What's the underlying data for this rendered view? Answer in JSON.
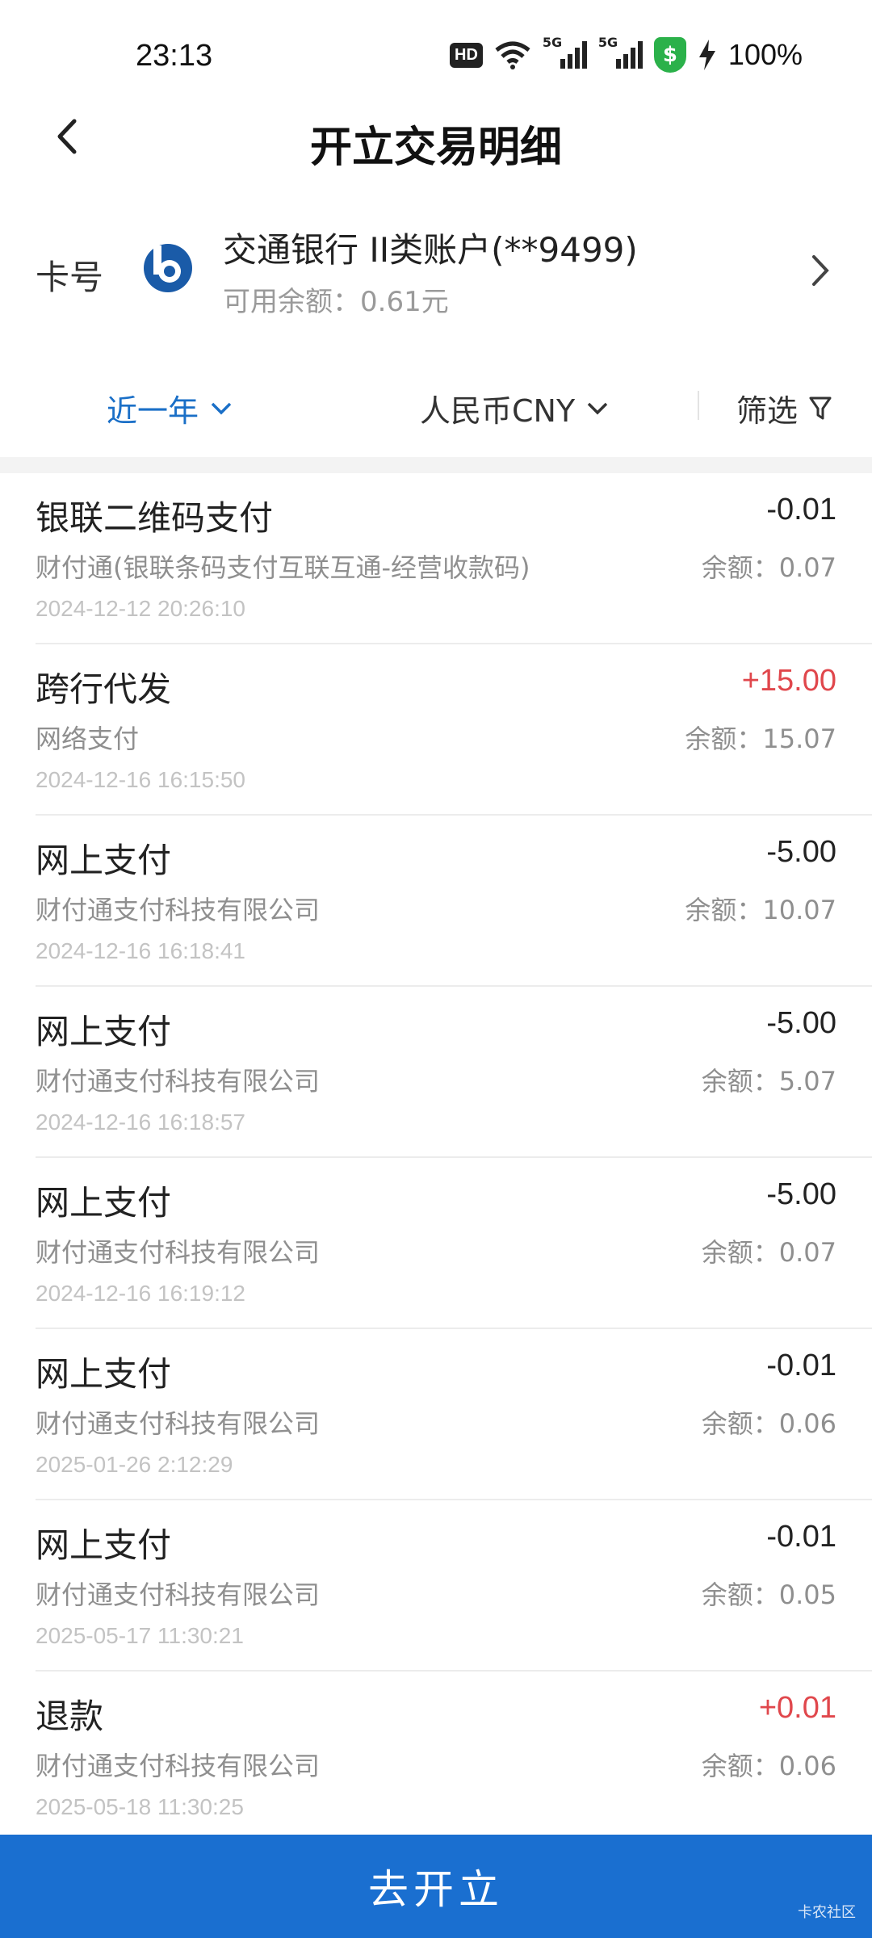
{
  "status": {
    "time": "23:13",
    "hd": "HD",
    "net1": "5G",
    "net2": "5G",
    "battery": "100%"
  },
  "header": {
    "title": "开立交易明细"
  },
  "card": {
    "label": "卡号",
    "bank_name": "交通银行 II类账户(**9499)",
    "balance": "可用余额：0.61元"
  },
  "filters": {
    "period": "近一年",
    "currency": "人民币CNY",
    "screen": "筛选"
  },
  "transactions": [
    {
      "title": "银联二维码支付",
      "amount": "-0.01",
      "merchant": "财付通(银联条码支付互联互通-经营收款码)",
      "balance": "余额：0.07",
      "time": "2024-12-12 20:26:10"
    },
    {
      "title": "跨行代发",
      "amount": "+15.00",
      "merchant": "网络支付",
      "balance": "余额：15.07",
      "time": "2024-12-16 16:15:50"
    },
    {
      "title": "网上支付",
      "amount": "-5.00",
      "merchant": "财付通支付科技有限公司",
      "balance": "余额：10.07",
      "time": "2024-12-16 16:18:41"
    },
    {
      "title": "网上支付",
      "amount": "-5.00",
      "merchant": "财付通支付科技有限公司",
      "balance": "余额：5.07",
      "time": "2024-12-16 16:18:57"
    },
    {
      "title": "网上支付",
      "amount": "-5.00",
      "merchant": "财付通支付科技有限公司",
      "balance": "余额：0.07",
      "time": "2024-12-16 16:19:12"
    },
    {
      "title": "网上支付",
      "amount": "-0.01",
      "merchant": "财付通支付科技有限公司",
      "balance": "余额：0.06",
      "time": "2025-01-26 2:12:29"
    },
    {
      "title": "网上支付",
      "amount": "-0.01",
      "merchant": "财付通支付科技有限公司",
      "balance": "余额：0.05",
      "time": "2025-05-17 11:30:21"
    },
    {
      "title": "退款",
      "amount": "+0.01",
      "merchant": "财付通支付科技有限公司",
      "balance": "余额：0.06",
      "time": "2025-05-18 11:30:25"
    }
  ],
  "bottom": {
    "button_label": "去开立"
  },
  "watermark": "卡农社区",
  "colors": {
    "accent": "#1a6fd0",
    "positive": "#e0474c"
  }
}
